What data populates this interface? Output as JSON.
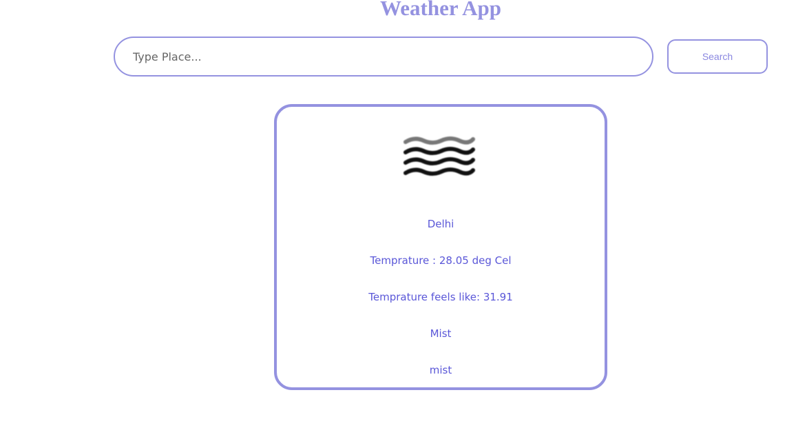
{
  "header": {
    "title": "Weather App"
  },
  "search": {
    "placeholder": "Type Place...",
    "value": "",
    "button_label": "Search"
  },
  "weather": {
    "icon": "mist-icon",
    "city": "Delhi",
    "temperature": "Temprature : 28.05 deg Cel",
    "feels_like": "Temprature feels like: 31.91",
    "condition": "Mist",
    "description": "mist"
  },
  "colors": {
    "accent": "#9492e0",
    "text": "#5a57d8",
    "background": "#ffffff"
  }
}
